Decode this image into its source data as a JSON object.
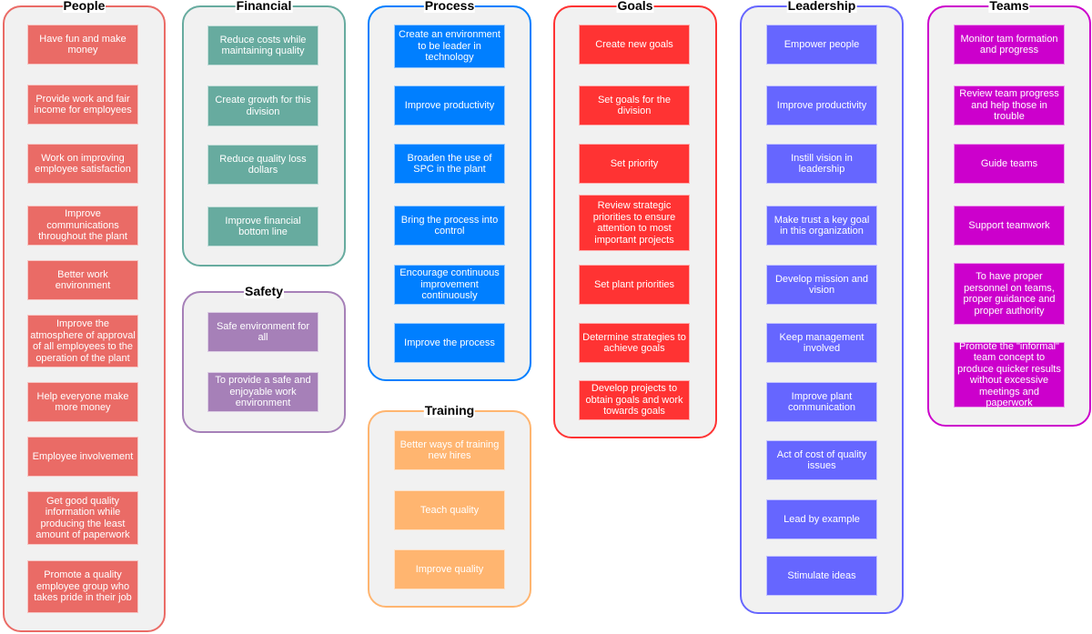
{
  "groups": [
    {
      "id": "people",
      "title": "People",
      "border_color": "#ea6b66",
      "fill_color": "#ea6b66",
      "items": [
        "Have fun and make money",
        "Provide work and fair income for employees",
        "Work on improving employee satisfaction",
        "Improve communications throughout the plant",
        "Better work environment",
        "Improve the atmosphere of approval of all employees to the operation of the plant",
        "Help everyone make more money",
        "Employee involvement",
        "Get good quality information while producing the least amount of paperwork",
        "Promote a quality employee group who takes pride in their job"
      ]
    },
    {
      "id": "financial",
      "title": "Financial",
      "border_color": "#67ab9f",
      "fill_color": "#67ab9f",
      "items": [
        "Reduce costs while maintaining quality",
        "Create growth for this division",
        "Reduce quality loss dollars",
        "Improve financial bottom line"
      ]
    },
    {
      "id": "safety",
      "title": "Safety",
      "border_color": "#a680b8",
      "fill_color": "#a680b8",
      "items": [
        "Safe environment for all",
        "To provide a safe and enjoyable work environment"
      ]
    },
    {
      "id": "process",
      "title": "Process",
      "border_color": "#007fff",
      "fill_color": "#007fff",
      "items": [
        "Create an environment to be leader in technology",
        "Improve productivity",
        "Broaden the use of SPC in the plant",
        "Bring the process into control",
        "Encourage continuous improvement continuously",
        "Improve the process"
      ]
    },
    {
      "id": "training",
      "title": "Training",
      "border_color": "#ffb570",
      "fill_color": "#ffb570",
      "items": [
        "Better ways of training new hires",
        "Teach quality",
        "Improve quality"
      ]
    },
    {
      "id": "goals",
      "title": "Goals",
      "border_color": "#ff3333",
      "fill_color": "#ff3333",
      "items": [
        "Create new goals",
        "Set goals for the division",
        "Set priority",
        "Review strategic priorities to ensure attention to most important projects",
        "Set plant priorities",
        "Determine strategies to achieve goals",
        "Develop projects to obtain goals and work towards goals"
      ]
    },
    {
      "id": "leadership",
      "title": "Leadership",
      "border_color": "#6666ff",
      "fill_color": "#6666ff",
      "items": [
        "Empower people",
        "Improve productivity",
        "Instill vision in leadership",
        "Make trust a key goal in this organization",
        "Develop mission and vision",
        "Keep management involved",
        "Improve plant communication",
        "Act of cost of quality issues",
        "Lead by example",
        "Stimulate ideas"
      ]
    },
    {
      "id": "teams",
      "title": "Teams",
      "border_color": "#cc00cc",
      "fill_color": "#cc00cc",
      "items": [
        "Monitor tam formation and progress",
        "Review team progress and help those in trouble",
        "Guide teams",
        "Support teamwork",
        "To have proper personnel on teams, proper guidance and proper authority",
        "Promote the \"informal\" team concept to produce quicker results without excessive meetings and paperwork"
      ]
    }
  ]
}
